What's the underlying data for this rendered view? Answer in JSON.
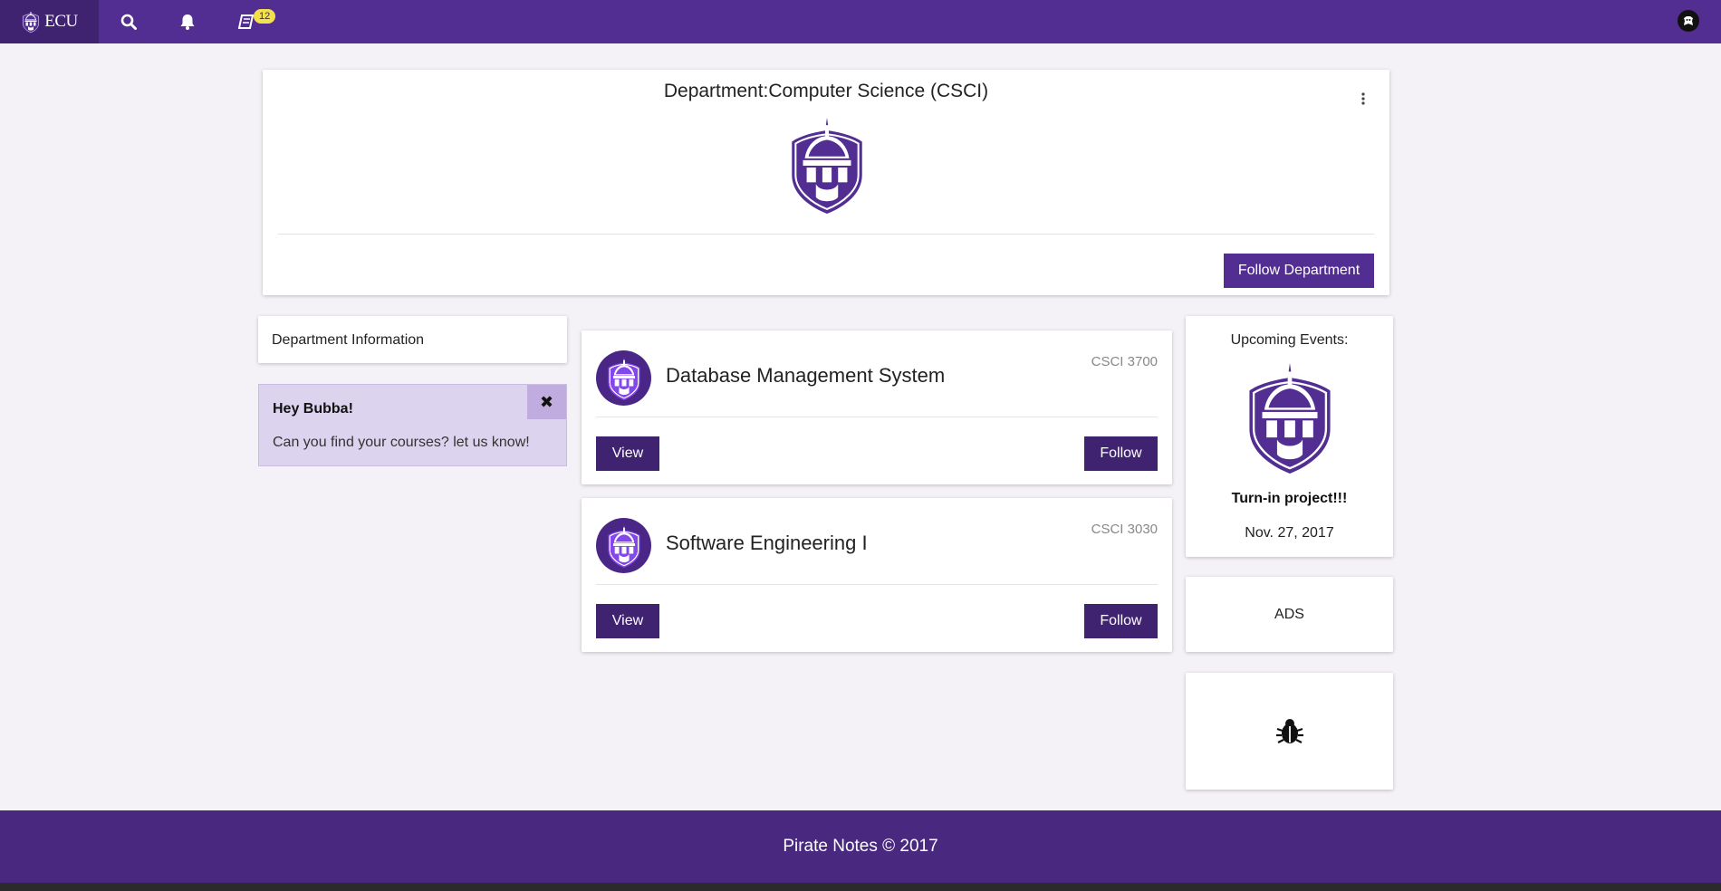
{
  "nav": {
    "brand_text": "ECU",
    "badge_count": "12",
    "icons": [
      "search-icon",
      "bell-icon",
      "book-icon",
      "user-avatar-icon"
    ]
  },
  "header": {
    "title": "Department:Computer Science (CSCI)",
    "follow_button": "Follow Department"
  },
  "sidebar": {
    "dept_info_label": "Department Information",
    "alert": {
      "title": "Hey Bubba!",
      "text": "Can you find your courses? let us know!",
      "close_glyph": "✖"
    }
  },
  "courses": [
    {
      "name": "Database Management System",
      "code": "CSCI 3700",
      "view_label": "View",
      "follow_label": "Follow"
    },
    {
      "name": "Software Engineering I",
      "code": "CSCI 3030",
      "view_label": "View",
      "follow_label": "Follow"
    }
  ],
  "events": {
    "title": "Upcoming Events:",
    "event_name": "Turn-in project!!!",
    "event_date": "Nov. 27, 2017"
  },
  "ads": {
    "label": "ADS"
  },
  "footer": {
    "text": "Pirate Notes © 2017"
  },
  "colors": {
    "primary": "#522d92",
    "primary_dark": "#3f2270",
    "background": "#f4f2f7",
    "alert_bg": "#dcd3ee",
    "badge": "#f4e04d"
  }
}
